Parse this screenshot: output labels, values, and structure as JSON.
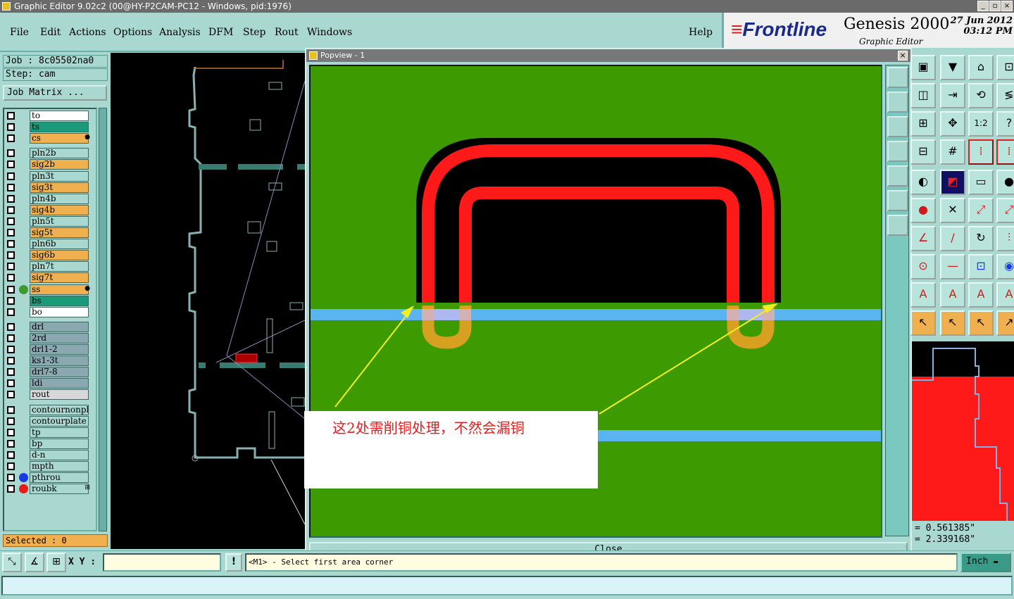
{
  "window": {
    "title": "Graphic Editor 9.02c2 (00@HY-P2CAM-PC12 - Windows, pid:1976)",
    "controls": [
      "_",
      "▫",
      "×"
    ]
  },
  "menu": [
    {
      "label": "File"
    },
    {
      "label": "Edit"
    },
    {
      "label": "Actions"
    },
    {
      "label": "Options"
    },
    {
      "label": "Analysis"
    },
    {
      "label": "DFM"
    },
    {
      "label": "Step"
    },
    {
      "label": "Rout"
    },
    {
      "label": "Windows"
    },
    {
      "label": "Help"
    }
  ],
  "brand": {
    "logo": "Frontline",
    "product": "Genesis 2000",
    "subtitle": "Graphic Editor",
    "date": "27 Jun 2012",
    "time": "03:12 PM"
  },
  "job": {
    "job_line": "Job : 8c05502na0",
    "step_line": "Step: cam",
    "matrix_button": "Job Matrix ..."
  },
  "layers": [
    {
      "name": "to",
      "bg": "#ffffff"
    },
    {
      "name": "ts",
      "bg": "#1a9a78"
    },
    {
      "name": "cs",
      "bg": "#f0b050",
      "mark": "●"
    },
    {
      "name": "pln2b",
      "bg": "#a8d8d0"
    },
    {
      "name": "sig2b",
      "bg": "#f0b050"
    },
    {
      "name": "pln3t",
      "bg": "#a8d8d0"
    },
    {
      "name": "sig3t",
      "bg": "#f0b050"
    },
    {
      "name": "pln4b",
      "bg": "#a8d8d0"
    },
    {
      "name": "sig4b",
      "bg": "#f0b050"
    },
    {
      "name": "pln5t",
      "bg": "#a8d8d0"
    },
    {
      "name": "sig5t",
      "bg": "#f0b050"
    },
    {
      "name": "pln6b",
      "bg": "#a8d8d0"
    },
    {
      "name": "sig6b",
      "bg": "#f0b050"
    },
    {
      "name": "pln7t",
      "bg": "#a8d8d0"
    },
    {
      "name": "sig7t",
      "bg": "#f0b050"
    },
    {
      "name": "ss",
      "bg": "#f0b050",
      "dot": "#3a9a2a",
      "mark": "●"
    },
    {
      "name": "bs",
      "bg": "#1a9a78"
    },
    {
      "name": "bo",
      "bg": "#ffffff"
    },
    {
      "name": "drl",
      "bg": "#8aa8b0"
    },
    {
      "name": "2rd",
      "bg": "#8aa8b0"
    },
    {
      "name": "drl1-2",
      "bg": "#8aa8b0"
    },
    {
      "name": "ks1-3t",
      "bg": "#8aa8b0"
    },
    {
      "name": "drl7-8",
      "bg": "#8aa8b0"
    },
    {
      "name": "ldi",
      "bg": "#8aa8b0"
    },
    {
      "name": "rout",
      "bg": "#d8d8d8"
    },
    {
      "name": "contournonpl",
      "bg": "#a8d8d0"
    },
    {
      "name": "contourplate",
      "bg": "#a8d8d0"
    },
    {
      "name": "tp",
      "bg": "#a8d8d0"
    },
    {
      "name": "bp",
      "bg": "#a8d8d0"
    },
    {
      "name": "d-n",
      "bg": "#a8d8d0"
    },
    {
      "name": "mpth",
      "bg": "#a8d8d0"
    },
    {
      "name": "pthrou",
      "bg": "#a8d8d0",
      "dot": "#1a3ae8"
    },
    {
      "name": "roubk",
      "bg": "#a8d8d0",
      "dot": "#e81a1a",
      "mark": "⊞"
    }
  ],
  "selected": "Selected : 0",
  "popview": {
    "title": "Popview - 1",
    "close_label": "Close",
    "annotation": "这2处需削铜处理，不然会漏铜"
  },
  "coords": {
    "x": "= 0.561385\"",
    "y": "= 2.339168\""
  },
  "bottom": {
    "xy_label": "X Y :",
    "xy_value": "",
    "warn": "!",
    "prompt": "<M1> - Select first area corner",
    "unit": "Inch"
  },
  "colors": {
    "accent": "#a8d8d0",
    "board_green": "#3d9a00",
    "copper_red": "#ff1a1a",
    "highlight_blue": "#5ab4f0",
    "arrow_yellow": "#f0f020"
  }
}
